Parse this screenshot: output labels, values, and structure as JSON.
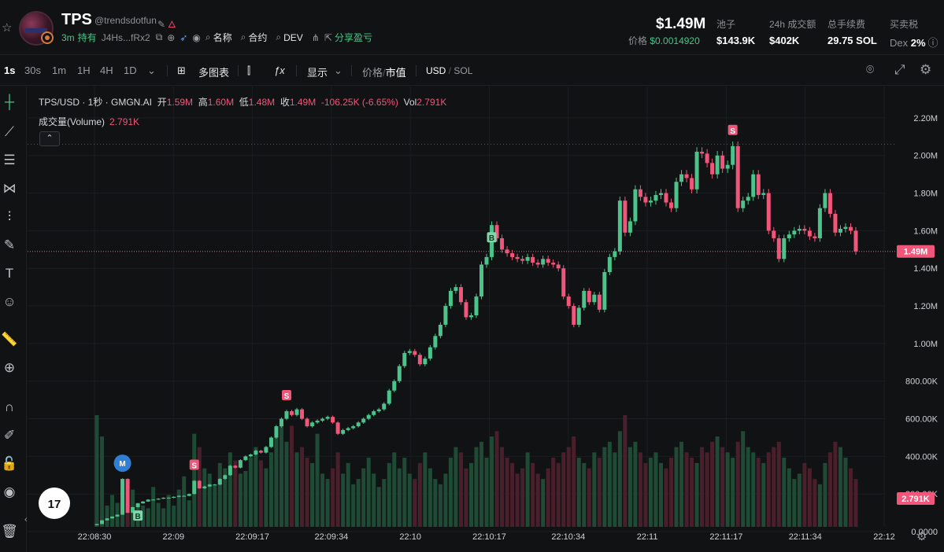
{
  "header": {
    "symbol": "TPS",
    "handle": "@trendsdotfun",
    "age": "3m",
    "holders_label": "持有",
    "address": "J4Hs...fRx2",
    "name_label": "名称",
    "contract_label": "合约",
    "dev_label": "DEV",
    "share_label": "分享盈亏",
    "market_cap": "$1.49M",
    "price_label": "价格",
    "price_value": "$0.0014920",
    "pool_label": "池子",
    "pool_value": "$143.9K",
    "volume_label": "24h 成交额",
    "volume_value": "$402K",
    "fee_label": "总手续费",
    "fee_value": "29.75 SOL",
    "tax_label": "买卖税",
    "tax_dex": "Dex",
    "tax_value": "2%"
  },
  "toolbar": {
    "intervals": [
      "1s",
      "30s",
      "1m",
      "1H",
      "4H",
      "1D"
    ],
    "active_interval": "1s",
    "multi_chart": "多图表",
    "display": "显示",
    "price_label": "价格",
    "mcap_label": "市值",
    "currency_usd": "USD",
    "currency_sol": "SOL"
  },
  "legend": {
    "title": "TPS/USD · 1秒 · GMGN.AI",
    "open_label": "开",
    "open": "1.59M",
    "high_label": "高",
    "high": "1.60M",
    "low_label": "低",
    "low": "1.48M",
    "close_label": "收",
    "close": "1.49M",
    "change": "-106.25K (-6.65%)",
    "vol_label": "Vol",
    "vol": "2.791K",
    "volume_study": "成交量(Volume)",
    "volume_value": "2.791K"
  },
  "colors": {
    "up": "#4cc38a",
    "down": "#f0557a",
    "background": "#111214",
    "grid": "#1c1d21"
  },
  "chart_data": {
    "type": "candlestick",
    "y_unit": "market cap USD",
    "ylim": [
      -50000,
      2300000
    ],
    "y_ticks": [
      "2.20M",
      "2.00M",
      "1.80M",
      "1.60M",
      "1.40M",
      "1.20M",
      "1.00M",
      "800.00K",
      "600.00K",
      "400.00K",
      "200.00K",
      "0.0000"
    ],
    "x_ticks": [
      "22:08:30",
      "22:09",
      "22:09:17",
      "22:09:34",
      "22:10",
      "22:10:17",
      "22:10:34",
      "22:11",
      "22:11:17",
      "22:11:34",
      "22:12"
    ],
    "last_price_label": "1.49M",
    "last_volume_label": "2.791K",
    "high_marker": 2060000,
    "closes": [
      40000,
      60000,
      70000,
      80000,
      90000,
      280000,
      100000,
      130000,
      150000,
      160000,
      170000,
      170000,
      175000,
      180000,
      180000,
      185000,
      190000,
      190000,
      200000,
      270000,
      230000,
      240000,
      250000,
      250000,
      280000,
      300000,
      350000,
      340000,
      380000,
      400000,
      410000,
      430000,
      420000,
      450000,
      500000,
      560000,
      600000,
      640000,
      620000,
      650000,
      600000,
      560000,
      580000,
      590000,
      600000,
      610000,
      580000,
      520000,
      540000,
      550000,
      560000,
      580000,
      600000,
      620000,
      640000,
      650000,
      680000,
      750000,
      800000,
      880000,
      950000,
      960000,
      940000,
      890000,
      920000,
      980000,
      1040000,
      1100000,
      1200000,
      1280000,
      1300000,
      1220000,
      1140000,
      1150000,
      1250000,
      1420000,
      1460000,
      1630000,
      1560000,
      1500000,
      1480000,
      1460000,
      1450000,
      1440000,
      1460000,
      1430000,
      1420000,
      1450000,
      1430000,
      1420000,
      1400000,
      1250000,
      1200000,
      1100000,
      1190000,
      1280000,
      1220000,
      1260000,
      1180000,
      1380000,
      1460000,
      1490000,
      1760000,
      1590000,
      1650000,
      1820000,
      1780000,
      1750000,
      1760000,
      1790000,
      1800000,
      1750000,
      1720000,
      1860000,
      1900000,
      1880000,
      1820000,
      2020000,
      2010000,
      1960000,
      1900000,
      2000000,
      1930000,
      1950000,
      2050000,
      1720000,
      1760000,
      1780000,
      1900000,
      1790000,
      1800000,
      1600000,
      1560000,
      1450000,
      1560000,
      1580000,
      1600000,
      1610000,
      1600000,
      1570000,
      1560000,
      1720000,
      1800000,
      1690000,
      1590000,
      1610000,
      1620000,
      1600000,
      1490000
    ],
    "volumes": [
      42000,
      34000,
      8000,
      12000,
      9000,
      10000,
      18000,
      14000,
      9000,
      8000,
      7000,
      15000,
      9000,
      7000,
      12000,
      8000,
      14000,
      19000,
      10000,
      35000,
      30000,
      22000,
      20000,
      16000,
      24000,
      22000,
      28000,
      25000,
      20000,
      21000,
      26000,
      30000,
      25000,
      22000,
      28000,
      35000,
      40000,
      32000,
      38000,
      28000,
      30000,
      26000,
      24000,
      35000,
      20000,
      18000,
      22000,
      28000,
      20000,
      24000,
      16000,
      18000,
      22000,
      26000,
      20000,
      15000,
      18000,
      24000,
      28000,
      22000,
      26000,
      20000,
      18000,
      24000,
      28000,
      22000,
      18000,
      16000,
      20000,
      26000,
      30000,
      28000,
      22000,
      24000,
      30000,
      32000,
      26000,
      34000,
      36000,
      30000,
      26000,
      24000,
      20000,
      22000,
      28000,
      24000,
      20000,
      18000,
      22000,
      26000,
      24000,
      28000,
      30000,
      34000,
      26000,
      24000,
      22000,
      28000,
      26000,
      30000,
      32000,
      28000,
      36000,
      42000,
      30000,
      32000,
      28000,
      24000,
      26000,
      28000,
      24000,
      22000,
      26000,
      30000,
      32000,
      28000,
      26000,
      24000,
      30000,
      28000,
      32000,
      34000,
      30000,
      28000,
      26000,
      32000,
      36000,
      30000,
      28000,
      26000,
      24000,
      28000,
      30000,
      32000,
      26000,
      22000,
      18000,
      20000,
      24000,
      22000,
      18000,
      16000,
      24000,
      28000,
      32000,
      30000,
      26000,
      22000,
      18000,
      3000
    ]
  }
}
